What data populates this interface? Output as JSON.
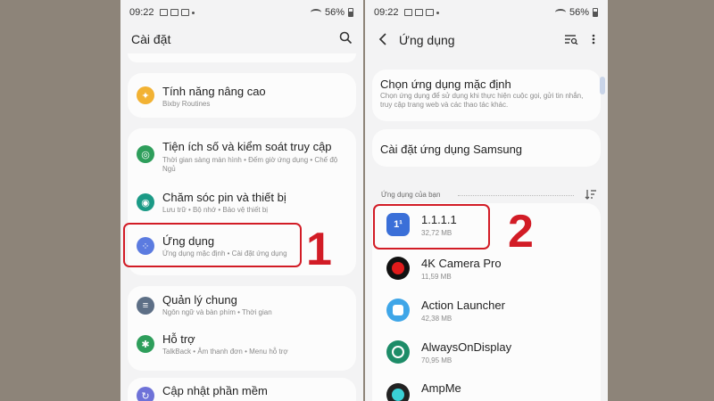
{
  "status": {
    "time": "09:22",
    "battery": "56%"
  },
  "left": {
    "title": "Cài đặt",
    "items": [
      {
        "title": "Tính năng nâng cao",
        "sub": "Bixby Routines",
        "color": "#f2b233"
      },
      {
        "title": "Tiện ích số và kiểm soát truy cập",
        "sub": "Thời gian sàng màn hình  •  Đếm giờ ứng dụng  •  Chế độ Ngủ",
        "color": "#2e9e5b"
      },
      {
        "title": "Chăm sóc pin và thiết bị",
        "sub": "Lưu trữ  •  Bộ nhớ  •  Bảo vệ thiết bị",
        "color": "#1b9a86"
      },
      {
        "title": "Ứng dụng",
        "sub": "Ứng dụng mặc định  •  Cài đặt ứng dụng",
        "color": "#5b7be0"
      },
      {
        "title": "Quản lý chung",
        "sub": "Ngôn ngữ và bàn phím  •  Thời gian",
        "color": "#5d6f86"
      },
      {
        "title": "Hỗ trợ",
        "sub": "TalkBack  •  Âm thanh đơn  •  Menu hỗ trợ",
        "color": "#2e9e5b"
      },
      {
        "title": "Cập nhật phần mềm",
        "sub": "",
        "color": "#6e72d8"
      }
    ],
    "step": "1"
  },
  "right": {
    "title": "Ứng dụng",
    "default_title": "Chọn ứng dụng mặc định",
    "default_sub": "Chọn ứng dụng để sử dụng khi thực hiện cuộc gọi, gửi tin nhắn, truy cập trang web và các thao tác khác.",
    "samsung": "Cài đặt ứng dụng Samsung",
    "section": "Ứng dụng của bạn",
    "apps": [
      {
        "name": "1.1.1.1",
        "size": "32,72 MB"
      },
      {
        "name": "4K Camera Pro",
        "size": "11,59 MB"
      },
      {
        "name": "Action Launcher",
        "size": "42,38 MB"
      },
      {
        "name": "AlwaysOnDisplay",
        "size": "70,95 MB"
      },
      {
        "name": "AmpMe",
        "size": ""
      }
    ],
    "step": "2"
  },
  "colors": {
    "highlight": "#d21c26",
    "background": "#8d8479"
  }
}
